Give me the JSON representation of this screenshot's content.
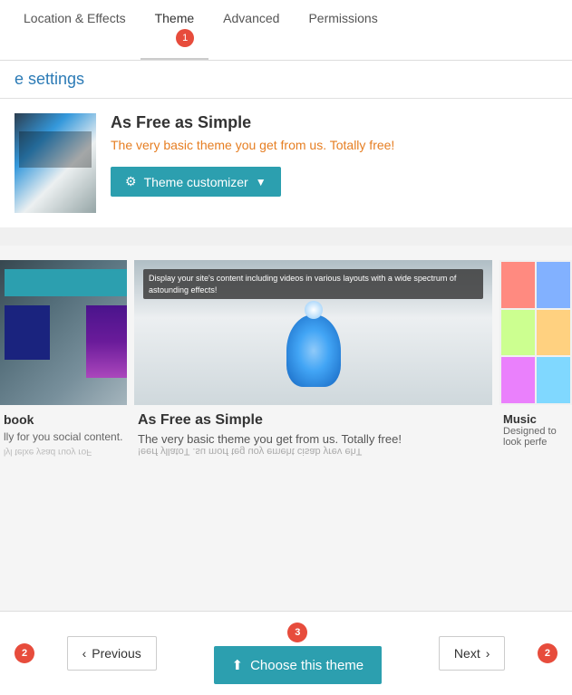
{
  "tabs": [
    {
      "id": "location-effects",
      "label": "Location & Effects",
      "active": false
    },
    {
      "id": "theme",
      "label": "Theme",
      "active": true,
      "badge": "1"
    },
    {
      "id": "advanced",
      "label": "Advanced",
      "active": false
    },
    {
      "id": "permissions",
      "label": "Permissions",
      "active": false
    }
  ],
  "page_settings_label": "e settings",
  "current_theme": {
    "name": "As Free as Simple",
    "description": "The very basic theme you get from us. Totally free!",
    "customizer_button": "Theme customizer"
  },
  "gallery": {
    "left_card": {
      "title": "book",
      "description": "lly for you social content.",
      "description2": "lyl telxe ysad ruoy roF"
    },
    "center_card": {
      "overlay_text": "Display your site's content including videos in various layouts with a wide spectrum of astounding effects!",
      "title": "As Free as Simple",
      "description": "The very basic theme you get from us. Totally free!",
      "description_flipped": "!eerf yllatoT .su morf teg uoy emeht cisab yrev ehT"
    },
    "right_card": {
      "title": "Music",
      "description": "Designed to look perfe"
    }
  },
  "actions": {
    "previous_label": "Previous",
    "choose_label": "Choose this theme",
    "next_label": "Next",
    "badge2": "2",
    "badge3": "3"
  }
}
